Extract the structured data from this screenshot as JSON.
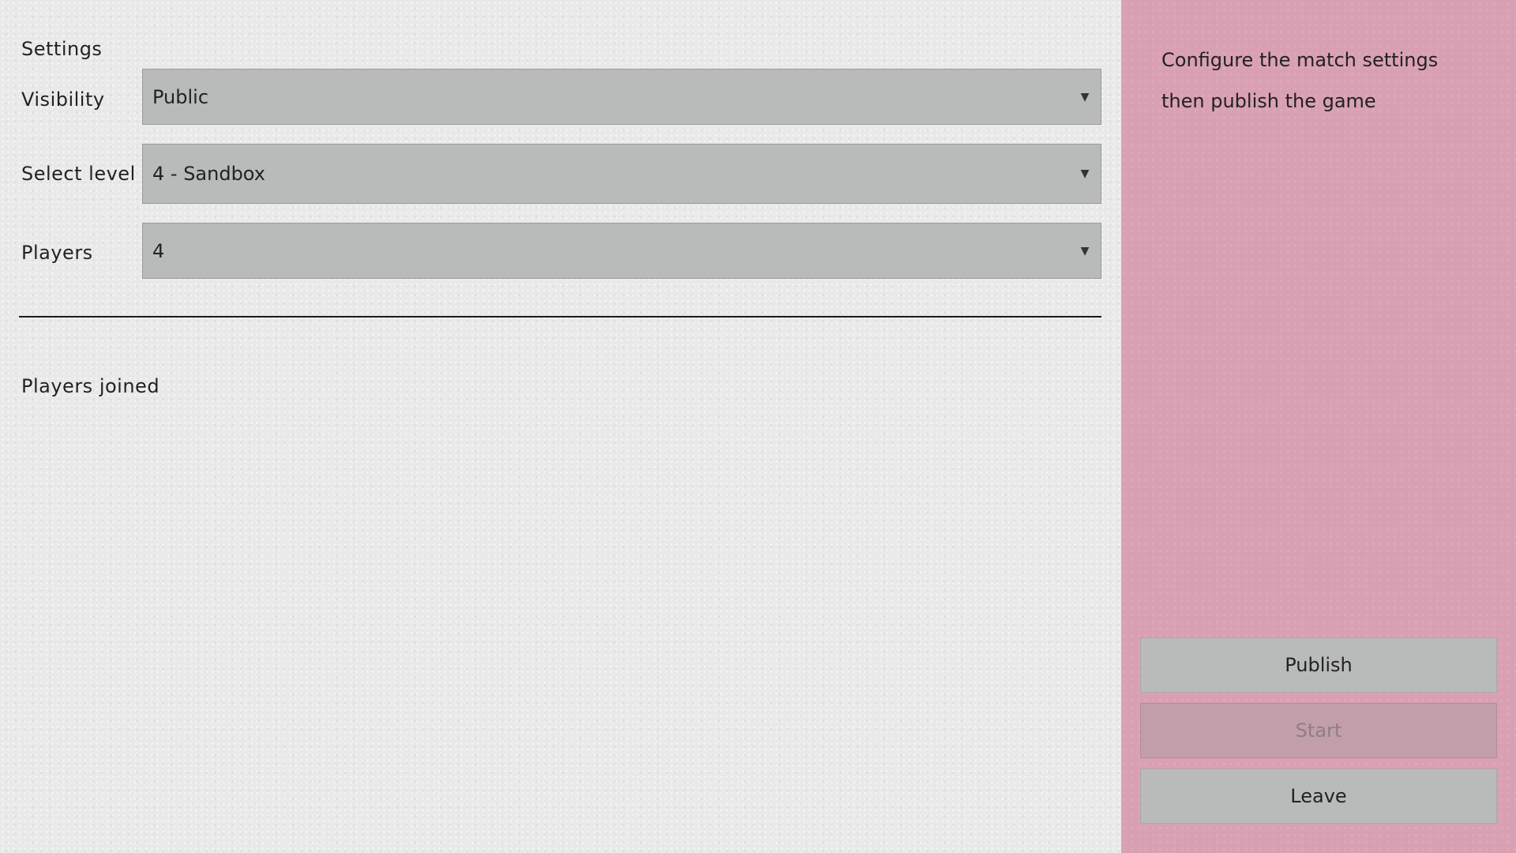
{
  "settings": {
    "heading": "Settings",
    "visibility": {
      "label": "Visibility",
      "value": "Public"
    },
    "level": {
      "label": "Select level",
      "value": "4 - Sandbox"
    },
    "players": {
      "label": "Players",
      "value": "4"
    }
  },
  "players_joined": {
    "heading": "Players joined"
  },
  "side_panel": {
    "instructions": "Configure the match settings then publish the game",
    "buttons": {
      "publish": "Publish",
      "start": "Start",
      "leave": "Leave"
    }
  },
  "icons": {
    "dropdown": "▼"
  },
  "colors": {
    "main_bg": "#e9e9ea",
    "side_bg": "#d9a0b4",
    "control_bg": "#b9bbba",
    "disabled_bg": "#c29eab"
  }
}
